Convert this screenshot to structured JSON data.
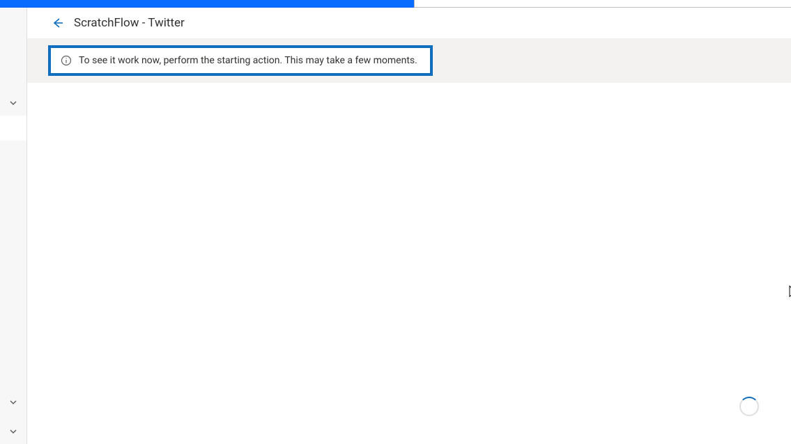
{
  "header": {
    "title": "ScratchFlow - Twitter"
  },
  "banner": {
    "message": "To see it work now, perform the starting action. This may take a few moments."
  }
}
